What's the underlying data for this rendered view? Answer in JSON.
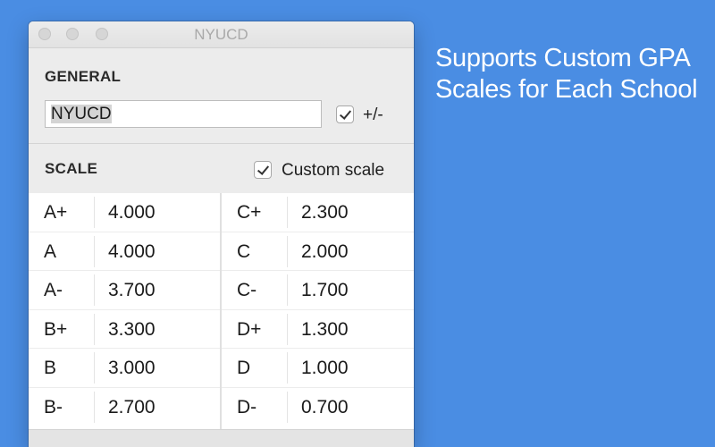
{
  "tagline": {
    "line1": "Supports Custom GPA",
    "line2": "Scales for Each School"
  },
  "window": {
    "title": "NYUCD"
  },
  "general": {
    "heading": "GENERAL",
    "name_value": "NYUCD",
    "plusminus_checked": true,
    "plusminus_label": "+/-"
  },
  "scale": {
    "heading": "SCALE",
    "custom_checked": true,
    "custom_label": "Custom scale",
    "left": [
      {
        "grade": "A+",
        "value": "4.000"
      },
      {
        "grade": "A",
        "value": "4.000"
      },
      {
        "grade": "A-",
        "value": "3.700"
      },
      {
        "grade": "B+",
        "value": "3.300"
      },
      {
        "grade": "B",
        "value": "3.000"
      },
      {
        "grade": "B-",
        "value": "2.700"
      }
    ],
    "right": [
      {
        "grade": "C+",
        "value": "2.300"
      },
      {
        "grade": "C",
        "value": "2.000"
      },
      {
        "grade": "C-",
        "value": "1.700"
      },
      {
        "grade": "D+",
        "value": "1.300"
      },
      {
        "grade": "D",
        "value": "1.000"
      },
      {
        "grade": "D-",
        "value": "0.700"
      }
    ]
  },
  "colors": {
    "background": "#4a8de3",
    "window": "#ececec"
  }
}
